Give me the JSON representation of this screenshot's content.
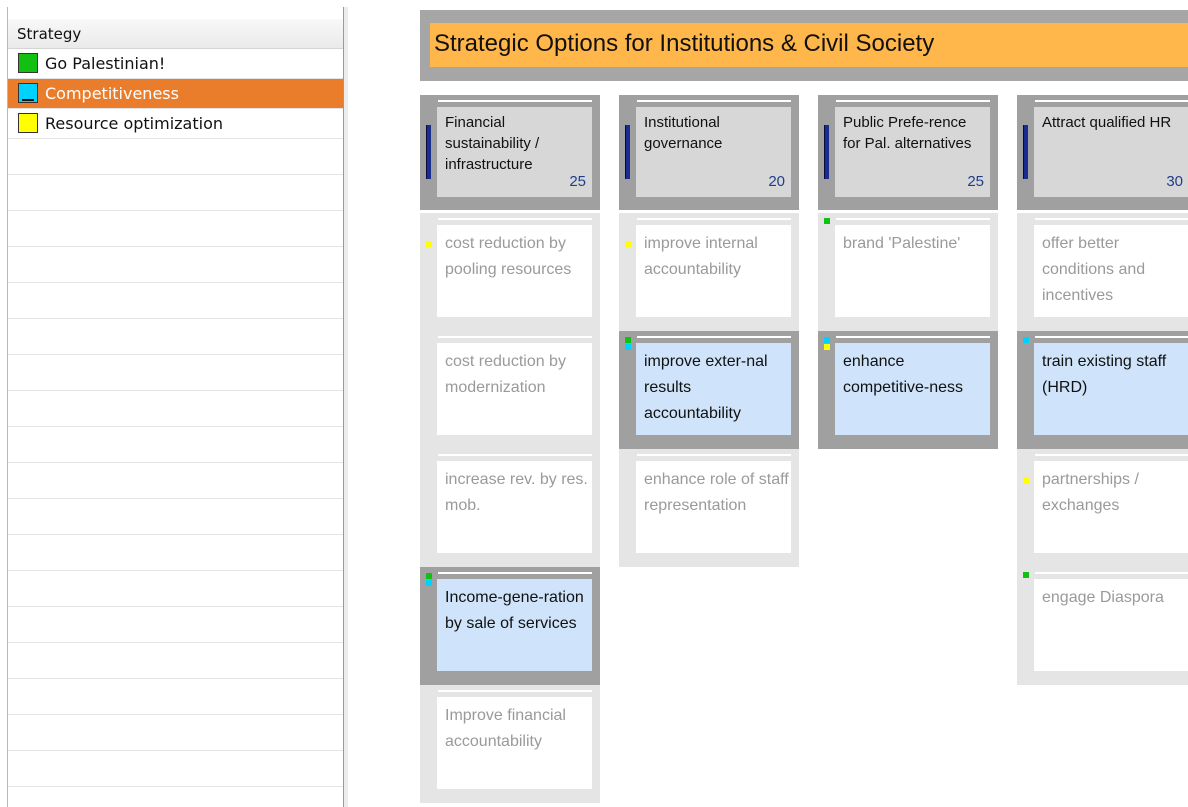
{
  "sidebar": {
    "header": "Strategy",
    "items": [
      {
        "label": "Go Palestinian!",
        "color": "#11c011",
        "selected": false
      },
      {
        "label": "Competitiveness",
        "color": "#00d2ff",
        "selected": true
      },
      {
        "label": "Resource optimization",
        "color": "#ffff00",
        "selected": false
      }
    ]
  },
  "board": {
    "title": "Strategic Options for Institutions & Civil Society",
    "columns": [
      {
        "header": "Financial sustainability / infrastructure",
        "weight": "25",
        "options": [
          {
            "text": "cost reduction by pooling resources",
            "highlighted": false,
            "tags": [
              "#ffff00"
            ]
          },
          {
            "text": "cost reduction by modernization",
            "highlighted": false,
            "tags": []
          },
          {
            "text": "increase rev. by res. mob.",
            "highlighted": false,
            "tags": []
          },
          {
            "text": "Income-gene-ration by sale of services",
            "highlighted": true,
            "tags": [
              "#11c011",
              "#00d2ff"
            ]
          },
          {
            "text": "Improve financial accountability",
            "highlighted": false,
            "tags": []
          }
        ]
      },
      {
        "header": "Institutional governance",
        "weight": "20",
        "options": [
          {
            "text": "improve internal accountability",
            "highlighted": false,
            "tags": [
              "#ffff00"
            ]
          },
          {
            "text": "improve exter-nal results accountability",
            "highlighted": true,
            "tags": [
              "#11c011",
              "#00d2ff"
            ]
          },
          {
            "text": "enhance role of staff representation",
            "highlighted": false,
            "tags": []
          }
        ]
      },
      {
        "header": "Public Prefe-rence for Pal. alternatives",
        "weight": "25",
        "options": [
          {
            "text": "brand 'Palestine'",
            "highlighted": false,
            "tags": [
              "#11c011"
            ]
          },
          {
            "text": "enhance competitive-ness",
            "highlighted": true,
            "tags": [
              "#00d2ff",
              "#ffff00"
            ]
          }
        ]
      },
      {
        "header": "Attract qualified HR",
        "weight": "30",
        "options": [
          {
            "text": "offer better conditions and incentives",
            "highlighted": false,
            "tags": []
          },
          {
            "text": "train existing staff (HRD)",
            "highlighted": true,
            "tags": [
              "#00d2ff"
            ]
          },
          {
            "text": "partnerships / exchanges",
            "highlighted": false,
            "tags": [
              "#ffff00"
            ]
          },
          {
            "text": "engage Diaspora",
            "highlighted": false,
            "tags": [
              "#11c011"
            ]
          }
        ]
      }
    ]
  }
}
